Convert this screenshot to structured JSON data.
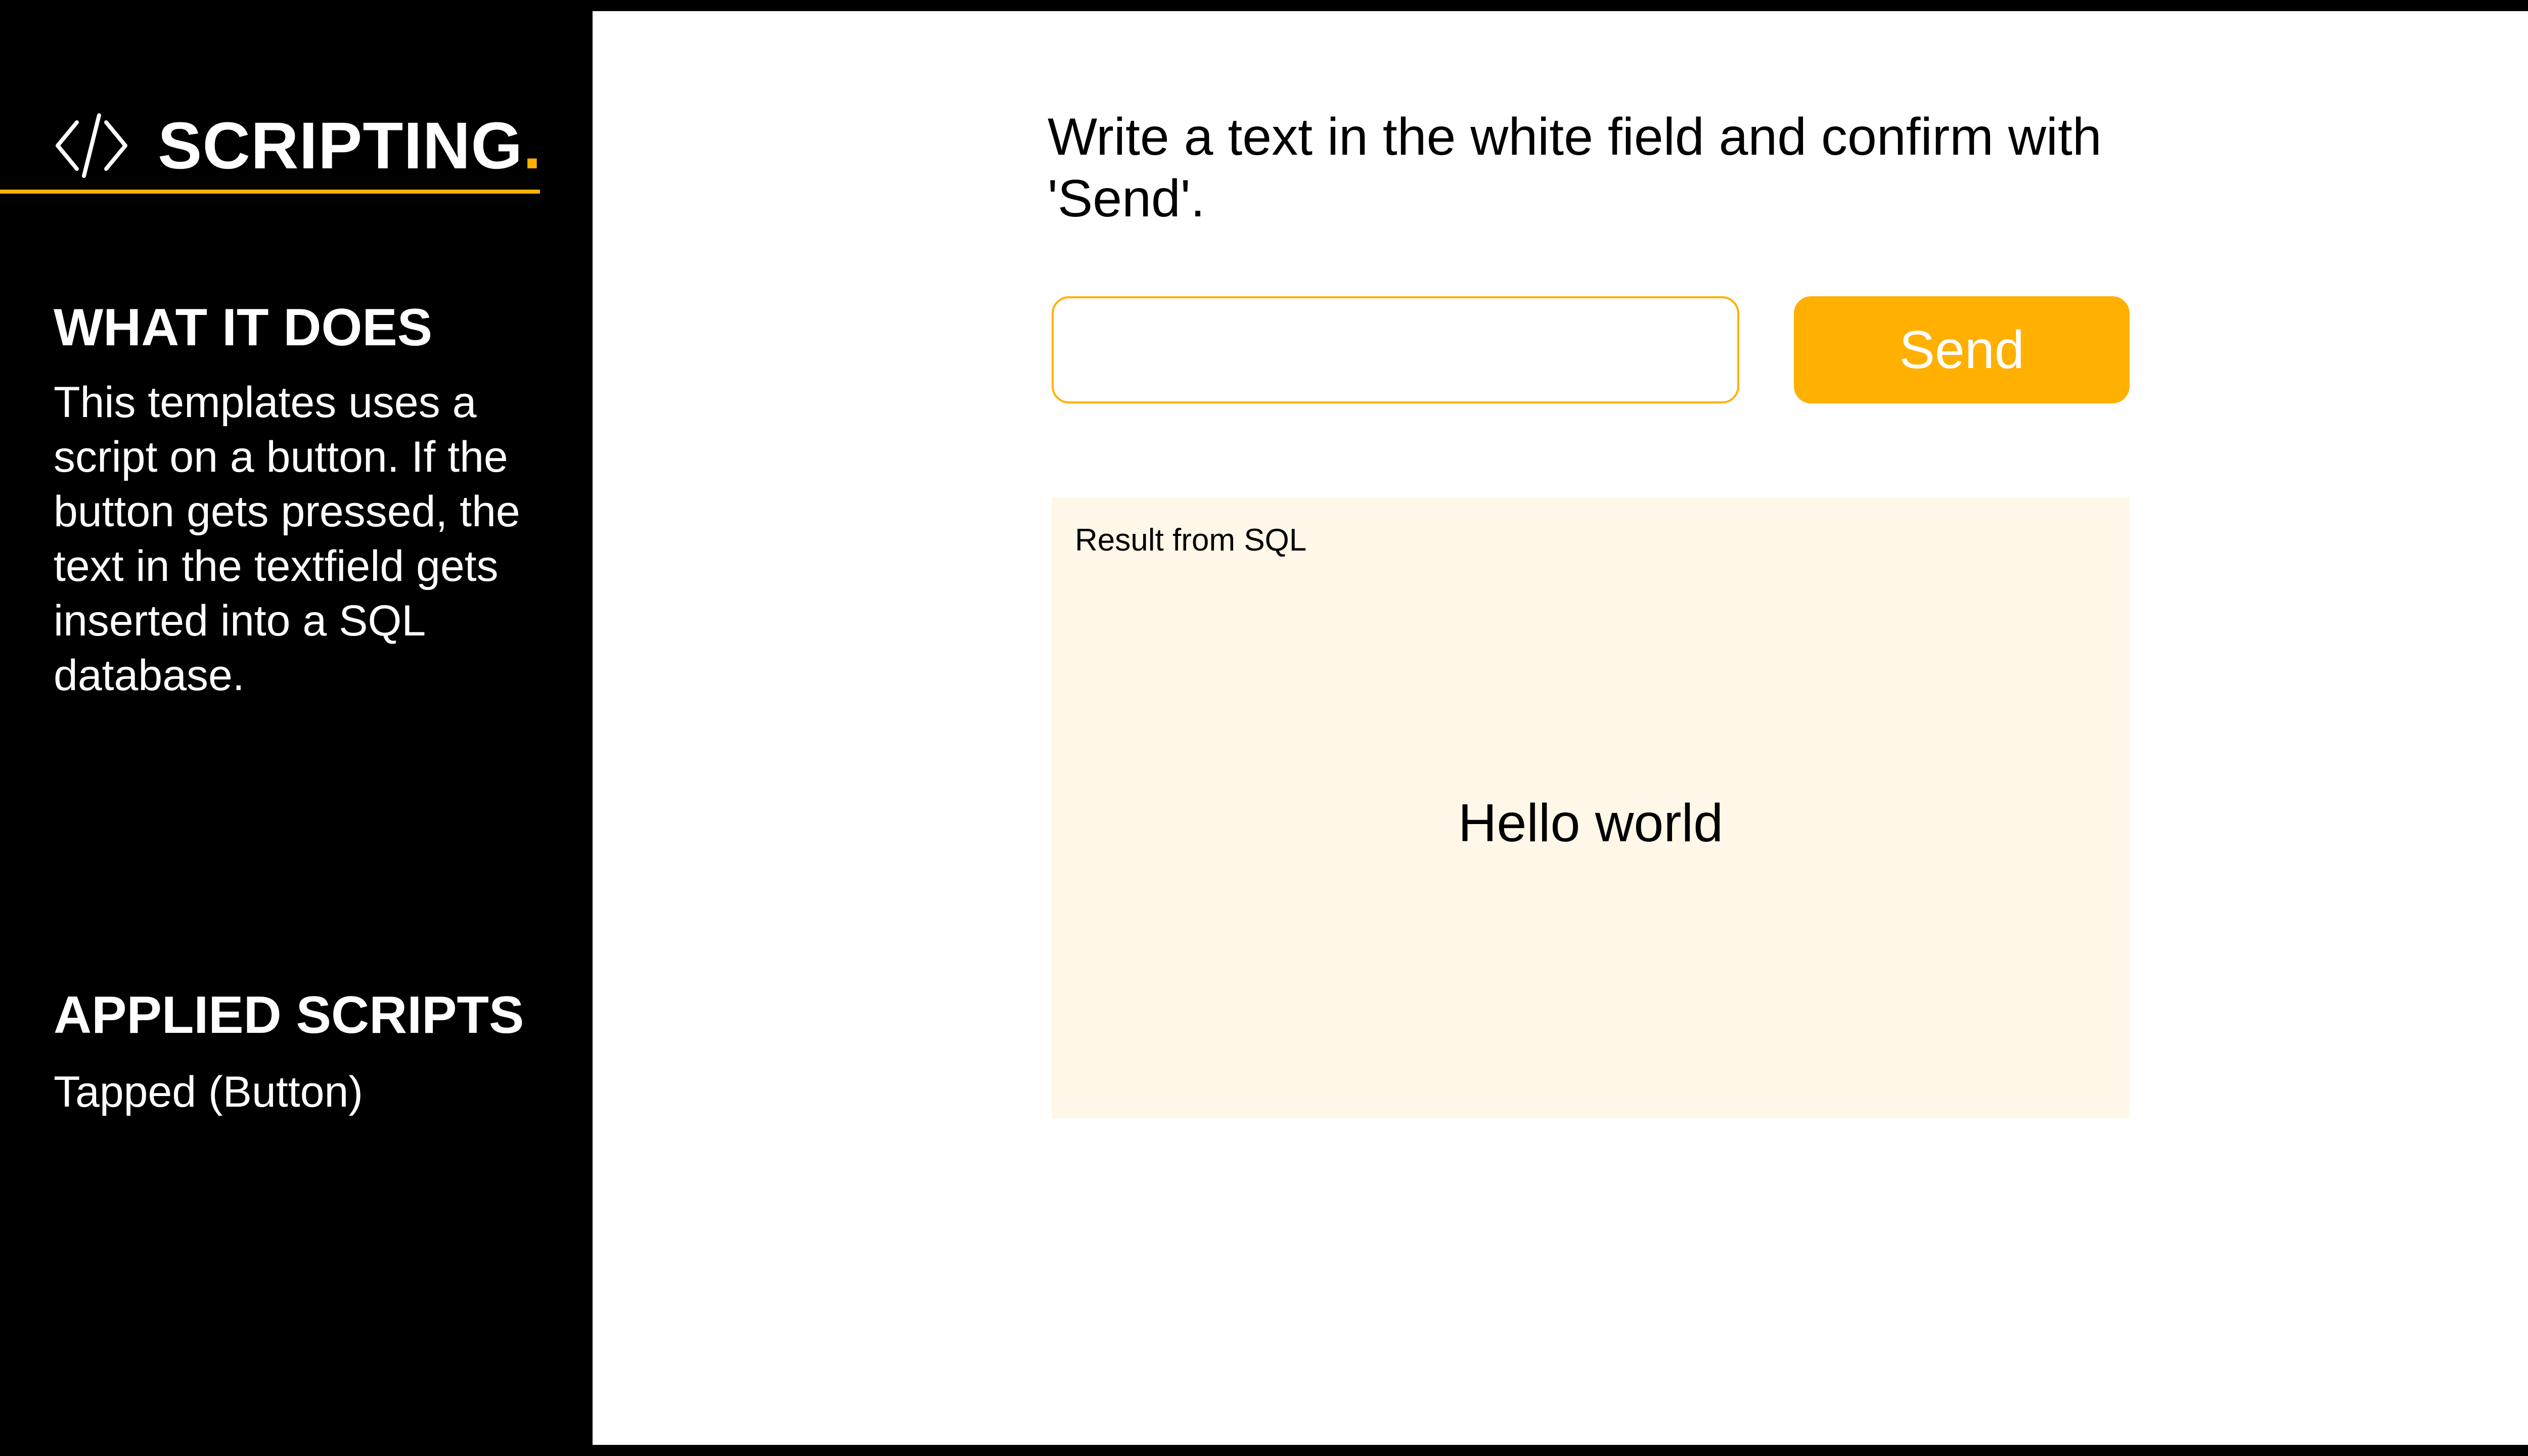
{
  "sidebar": {
    "brand": {
      "title": "SCRIPTING",
      "dot": ".",
      "icon": "code-brackets-icon",
      "accent_color": "#FFB000"
    },
    "what_it_does": {
      "heading": "WHAT IT DOES",
      "text": "This templates uses a script on a button. If the button gets pressed, the text in the textfield gets inserted into a SQL database."
    },
    "applied_scripts": {
      "heading": "APPLIED SCRIPTS",
      "text": "Tapped (Button)"
    }
  },
  "main": {
    "instruction": "Write a text in the white field and confirm with 'Send'.",
    "input": {
      "value": "",
      "placeholder": ""
    },
    "send_button": {
      "label": "Send",
      "color": "#FFB000"
    },
    "result": {
      "label": "Result from SQL",
      "value": "Hello world",
      "background": "#FFF7E8"
    }
  }
}
